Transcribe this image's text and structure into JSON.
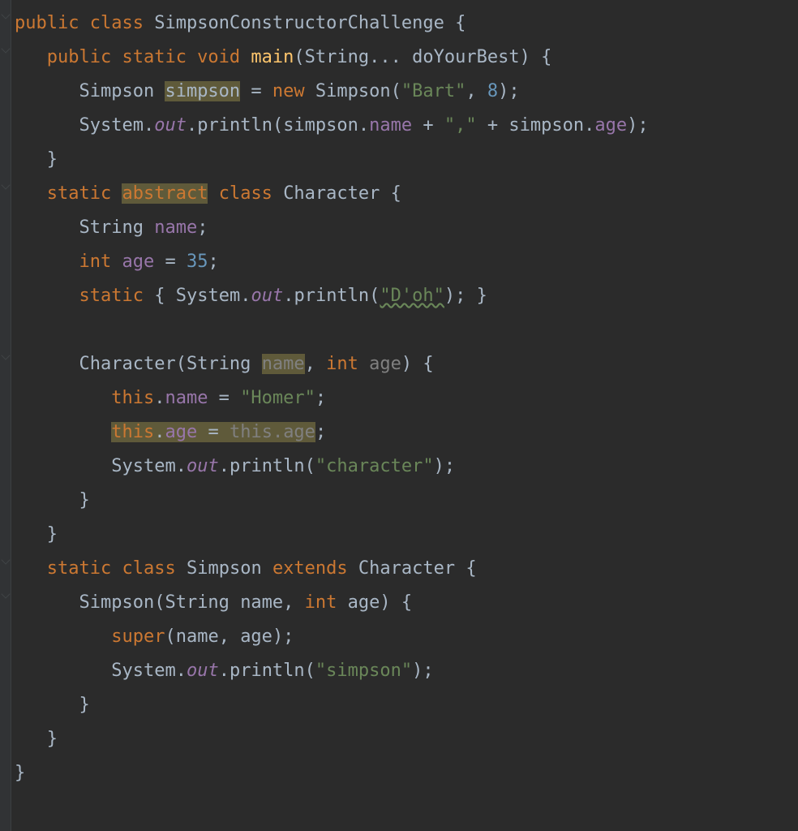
{
  "code": {
    "l1": {
      "kw1": "public",
      "kw2": "class",
      "cls": "SimpsonConstructorChallenge",
      "br": "{"
    },
    "l2": {
      "kw": "public static void",
      "mth": "main",
      "open": "(",
      "ptype": "String",
      "dots": "...",
      "pname": "doYourBest",
      "close": ") {"
    },
    "l3": {
      "type": "Simpson",
      "var": "simpson",
      "eq": " = ",
      "kw": "new",
      "ctor": "Simpson",
      "open": "(",
      "s": "\"Bart\"",
      "comma": ", ",
      "n": "8",
      "close": ");"
    },
    "l4": {
      "sys": "System",
      "dot1": ".",
      "out": "out",
      "dot2": ".",
      "mth": "println",
      "open": "(",
      "arg1": "simpson",
      "dot3": ".",
      "f1": "name",
      "plus1": " + ",
      "s1": "\",\"",
      "plus2": " + ",
      "arg2": "simpson",
      "dot4": ".",
      "f2": "age",
      "close": ");"
    },
    "l5": {
      "br": "}"
    },
    "l6": {
      "kw1": "static",
      "kw2": "abstract",
      "kw3": "class",
      "cls": "Character",
      "br": "{"
    },
    "l7": {
      "type": "String",
      "fld": "name",
      "semi": ";"
    },
    "l8": {
      "type": "int",
      "fld": "age",
      "eq": " = ",
      "n": "35",
      "semi": ";"
    },
    "l9": {
      "kw": "static",
      "open": " { ",
      "sys": "System",
      "dot1": ".",
      "out": "out",
      "dot2": ".",
      "mth": "println",
      "popen": "(",
      "s": "\"D'oh\"",
      "pclose": ");",
      " close": " }"
    },
    "l10": {
      "ctor": "Character",
      "open": "(",
      "t1": "String",
      "p1": "name",
      "comma": ", ",
      "t2": "int",
      "p2": "age",
      "close": ") {"
    },
    "l11": {
      "kw": "this",
      "dot": ".",
      "fld": "name",
      "eq": " = ",
      "s": "\"Homer\"",
      "semi": ";"
    },
    "l12": {
      "kw1": "this",
      "dot1": ".",
      "fld1": "age",
      "eq": " = ",
      "kw2": "this",
      "dot2": ".",
      "fld2": "age",
      "semi": ";"
    },
    "l13": {
      "sys": "System",
      "dot1": ".",
      "out": "out",
      "dot2": ".",
      "mth": "println",
      "open": "(",
      "s": "\"character\"",
      "close": ");"
    },
    "l14": {
      "br": "}"
    },
    "l15": {
      "br": "}"
    },
    "l16": {
      "kw1": "static",
      "kw2": "class",
      "cls": "Simpson",
      "kw3": "extends",
      "sup": "Character",
      "br": "{"
    },
    "l17": {
      "ctor": "Simpson",
      "open": "(",
      "t1": "String",
      "p1": "name",
      "comma": ", ",
      "t2": "int",
      "p2": "age",
      "close": ") {"
    },
    "l18": {
      "kw": "super",
      "open": "(",
      "a1": "name",
      "comma": ", ",
      "a2": "age",
      "close": ");"
    },
    "l19": {
      "sys": "System",
      "dot1": ".",
      "out": "out",
      "dot2": ".",
      "mth": "println",
      "open": "(",
      "s": "\"simpson\"",
      "close": ");"
    },
    "l20": {
      "br": "}"
    },
    "l21": {
      "br": "}"
    },
    "l22": {
      "br": "}"
    }
  }
}
